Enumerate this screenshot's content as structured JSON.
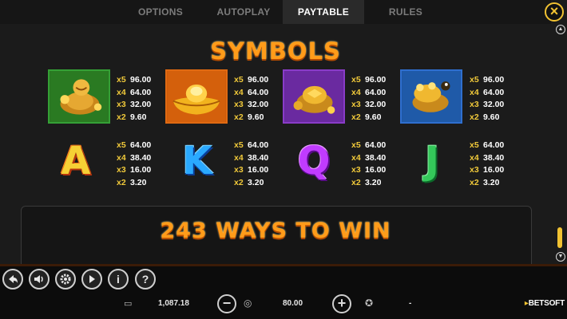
{
  "tabs": [
    {
      "label": "OPTIONS"
    },
    {
      "label": "AUTOPLAY"
    },
    {
      "label": "PAYTABLE"
    },
    {
      "label": "RULES"
    }
  ],
  "active_tab": "PAYTABLE",
  "close_icon": "close-icon",
  "symbols_title": "SYMBOLS",
  "premium_symbols": [
    {
      "name": "buddha",
      "icon": "laughing-buddha-icon",
      "frame_color": "#35a036",
      "pays": [
        {
          "mult": "x5",
          "amount": "96.00"
        },
        {
          "mult": "x4",
          "amount": "64.00"
        },
        {
          "mult": "x3",
          "amount": "32.00"
        },
        {
          "mult": "x2",
          "amount": "9.60"
        }
      ]
    },
    {
      "name": "gold-ingot",
      "icon": "gold-ingot-icon",
      "frame_color": "#e06a12",
      "pays": [
        {
          "mult": "x5",
          "amount": "96.00"
        },
        {
          "mult": "x4",
          "amount": "64.00"
        },
        {
          "mult": "x3",
          "amount": "32.00"
        },
        {
          "mult": "x2",
          "amount": "9.60"
        }
      ]
    },
    {
      "name": "turtle",
      "icon": "golden-turtle-icon",
      "frame_color": "#8a3cc8",
      "pays": [
        {
          "mult": "x5",
          "amount": "96.00"
        },
        {
          "mult": "x4",
          "amount": "64.00"
        },
        {
          "mult": "x3",
          "amount": "32.00"
        },
        {
          "mult": "x2",
          "amount": "9.60"
        }
      ]
    },
    {
      "name": "toad",
      "icon": "money-toad-icon",
      "frame_color": "#2f6fcf",
      "pays": [
        {
          "mult": "x5",
          "amount": "96.00"
        },
        {
          "mult": "x4",
          "amount": "64.00"
        },
        {
          "mult": "x3",
          "amount": "32.00"
        },
        {
          "mult": "x2",
          "amount": "9.60"
        }
      ]
    }
  ],
  "letter_symbols": [
    {
      "letter": "A",
      "pays": [
        {
          "mult": "x5",
          "amount": "64.00"
        },
        {
          "mult": "x4",
          "amount": "38.40"
        },
        {
          "mult": "x3",
          "amount": "16.00"
        },
        {
          "mult": "x2",
          "amount": "3.20"
        }
      ]
    },
    {
      "letter": "K",
      "pays": [
        {
          "mult": "x5",
          "amount": "64.00"
        },
        {
          "mult": "x4",
          "amount": "38.40"
        },
        {
          "mult": "x3",
          "amount": "16.00"
        },
        {
          "mult": "x2",
          "amount": "3.20"
        }
      ]
    },
    {
      "letter": "Q",
      "pays": [
        {
          "mult": "x5",
          "amount": "64.00"
        },
        {
          "mult": "x4",
          "amount": "38.40"
        },
        {
          "mult": "x3",
          "amount": "16.00"
        },
        {
          "mult": "x2",
          "amount": "3.20"
        }
      ]
    },
    {
      "letter": "J",
      "pays": [
        {
          "mult": "x5",
          "amount": "64.00"
        },
        {
          "mult": "x4",
          "amount": "38.40"
        },
        {
          "mult": "x3",
          "amount": "16.00"
        },
        {
          "mult": "x2",
          "amount": "3.20"
        }
      ]
    }
  ],
  "ways_title": "243 WAYS TO WIN",
  "footer": {
    "balance": "1,087.18",
    "bet": "80.00",
    "win": "-",
    "brand_prefix": "▸",
    "brand": "BETSOFT"
  },
  "controls": [
    {
      "icon": "back-arrow-icon"
    },
    {
      "icon": "sound-icon"
    },
    {
      "icon": "settings-gear-icon"
    },
    {
      "icon": "autoplay-icon"
    },
    {
      "icon": "info-icon"
    },
    {
      "icon": "help-icon"
    }
  ],
  "colors": {
    "accent": "#f1c232",
    "title_orange": "#ff9c1a"
  }
}
